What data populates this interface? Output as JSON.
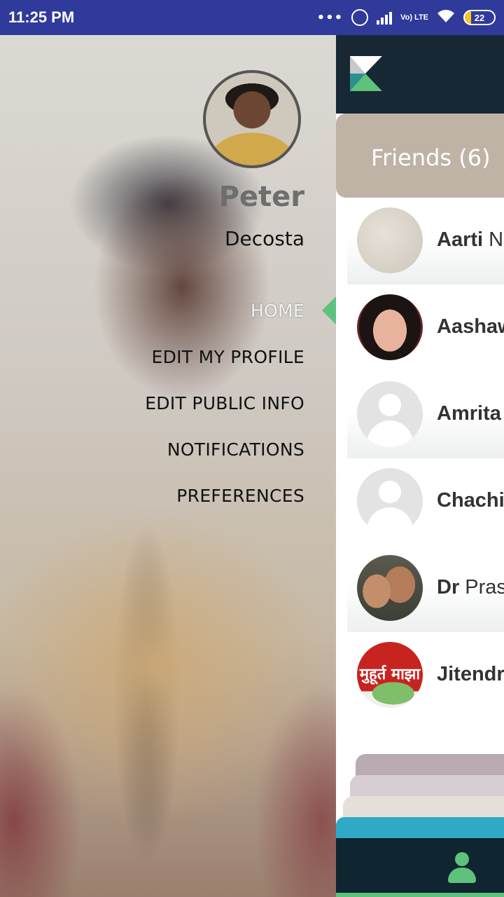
{
  "status_bar": {
    "time": "11:25 PM",
    "dots": "•••",
    "network": "Vo) LTE",
    "battery": "22",
    "icons": [
      "alarm-icon",
      "signal-icon",
      "wifi-icon",
      "battery-icon"
    ]
  },
  "drawer": {
    "first_name": "Peter",
    "last_name": "Decosta",
    "menu": [
      {
        "label": "HOME",
        "active": true
      },
      {
        "label": "EDIT MY PROFILE",
        "active": false
      },
      {
        "label": "EDIT PUBLIC INFO",
        "active": false
      },
      {
        "label": "NOTIFICATIONS",
        "active": false
      },
      {
        "label": "PREFERENCES",
        "active": false
      }
    ]
  },
  "main": {
    "friends_title": "Friends (6)",
    "friends": [
      {
        "bold": "Aarti",
        "rest": " Na"
      },
      {
        "bold": "Aashaw",
        "rest": ""
      },
      {
        "bold": "Amrita",
        "rest": ""
      },
      {
        "bold": "Chachi",
        "rest": ""
      },
      {
        "bold": "Dr",
        "rest": " Pras"
      },
      {
        "bold": "Jitendr",
        "rest": ""
      }
    ],
    "avatar_text": "मुहूर्त माझा"
  },
  "colors": {
    "status_bar": "#2f3a9b",
    "app_bar": "#172734",
    "accent_green": "#5ec27d",
    "friends_header": "#bfb3a6"
  }
}
